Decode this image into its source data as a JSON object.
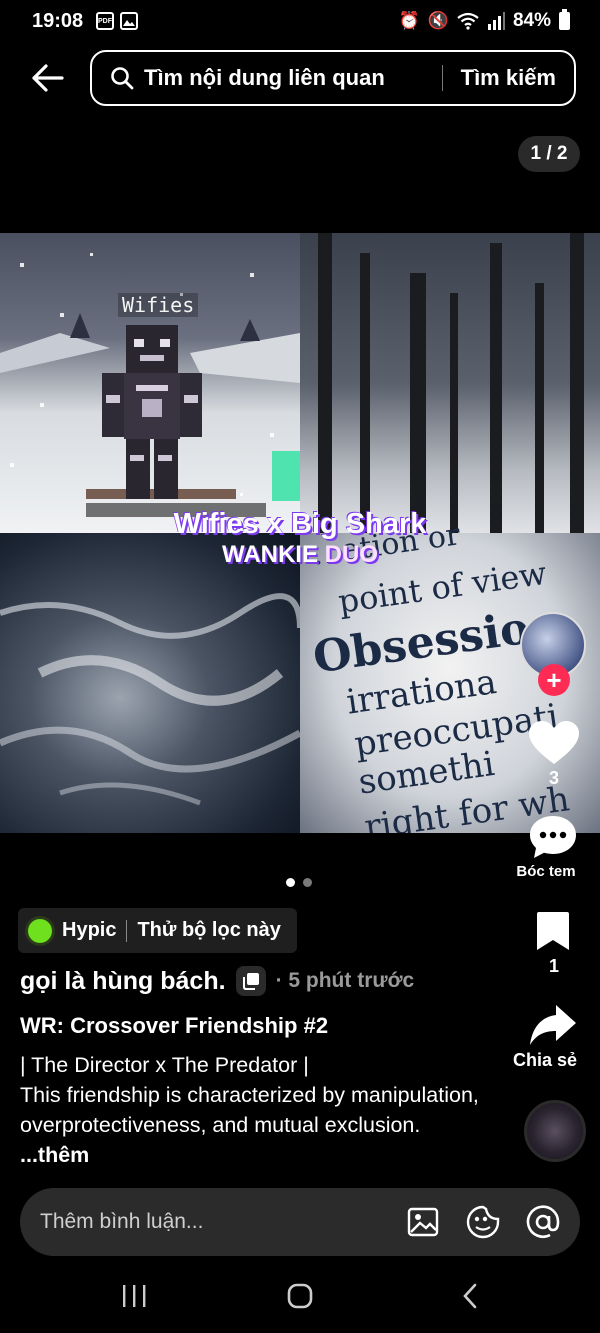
{
  "status_bar": {
    "time": "19:08",
    "battery": "84%",
    "left_icons": [
      "pdf-notification-icon",
      "image-notification-icon"
    ],
    "right_icons": [
      "alarm-icon",
      "mute-icon",
      "wifi-icon",
      "signal-icon",
      "battery-icon"
    ]
  },
  "header": {
    "search_placeholder": "Tìm nội dung liên quan",
    "search_button": "Tìm kiếm",
    "page_counter": "1 / 2"
  },
  "media": {
    "minecraft_nametag": "Wifies",
    "caption_line1": "Wifies x Big Shark",
    "caption_line2_a": "WANKIE ",
    "caption_line2_b": "DUO",
    "dictionary_lines": [
      "…ation or",
      "point of view",
      "Obsessio",
      "irrationa",
      "preoccupati",
      "somethi",
      "right for wh"
    ],
    "carousel_total": 2,
    "carousel_index": 1
  },
  "actions": {
    "like_count": "3",
    "comment_label": "Bóc tem",
    "bookmark_count": "1",
    "share_label": "Chia sẻ"
  },
  "post": {
    "filter_name": "Hypic",
    "filter_action": "Thử bộ lọc này",
    "author": "gọi là hùng bách.",
    "time": "· 5 phút trước",
    "title": "WR: Crossover Friendship #2",
    "description": "| The Director x The Predator |\nThis friendship is characterized by manipulation, overprotectiveness, and mutual exclusion. ",
    "more": "...thêm"
  },
  "comment_bar": {
    "placeholder": "Thêm bình luận..."
  },
  "colors": {
    "background": "#000000",
    "follow": "#fe2c55",
    "filter_dot": "#6ee01e",
    "caption_outline": "#7c3aed"
  }
}
